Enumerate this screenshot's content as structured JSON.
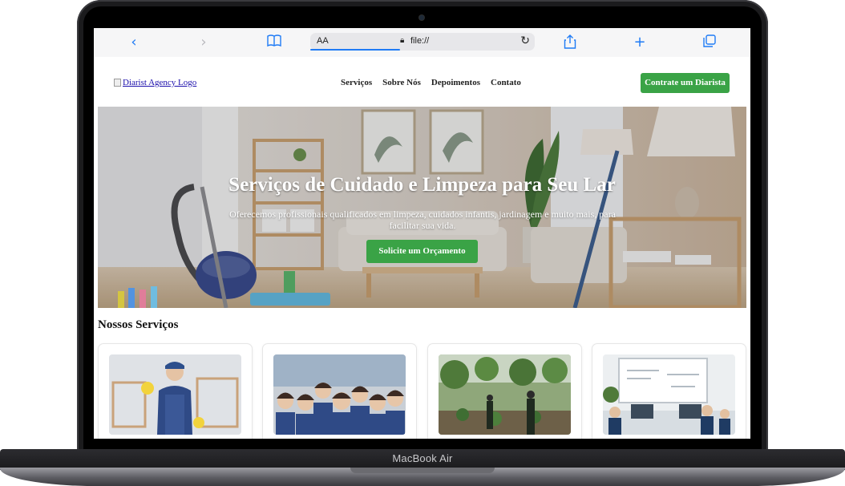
{
  "device": {
    "label": "MacBook Air"
  },
  "browser": {
    "text_size_label": "AA",
    "url": "file://",
    "icons": [
      "back-icon",
      "forward-icon",
      "bookmarks-icon",
      "lock-icon",
      "reload-icon",
      "share-icon",
      "new-tab-icon",
      "tabs-icon"
    ]
  },
  "site": {
    "logo_alt": "Diarist Agency Logo",
    "nav": [
      "Serviços",
      "Sobre Nós",
      "Depoimentos",
      "Contato"
    ],
    "nav_cta": "Contrate um Diarista",
    "hero": {
      "title": "Serviços de Cuidado e Limpeza para Seu Lar",
      "subtitle": "Oferecemos profissionais qualificados em limpeza, cuidados infantis, jardinagem e muito mais, para facilitar sua vida.",
      "button": "Solicite um Orçamento"
    },
    "services_title": "Nossos Serviços",
    "service_cards": [
      {
        "image": "cleaning-worker-image"
      },
      {
        "image": "team-of-workers-image"
      },
      {
        "image": "gardening-team-image"
      },
      {
        "image": "office-workers-image"
      }
    ]
  },
  "colors": {
    "accent_green": "#3aa346",
    "link": "#1a0dab",
    "safari_blue": "#1f7bf5"
  }
}
